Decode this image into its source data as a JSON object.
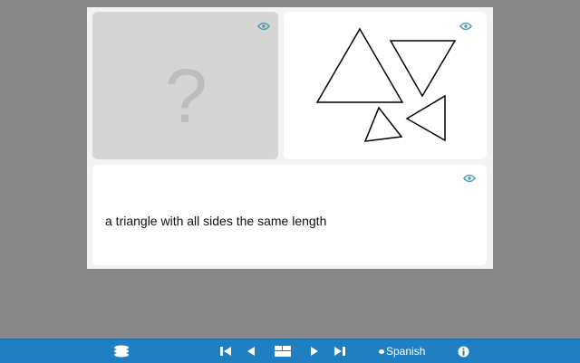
{
  "card": {
    "question_placeholder": "?",
    "description": "a triangle with all sides the same length"
  },
  "toolbar": {
    "language_label": "Spanish",
    "icons": [
      "layers-icon",
      "first-icon",
      "prev-icon",
      "card-view-icon",
      "next-icon",
      "last-icon",
      "speech-icon",
      "info-icon"
    ]
  },
  "colors": {
    "background": "#878787",
    "toolbar": "#1f7fc1",
    "eye": "#5a9eae"
  }
}
